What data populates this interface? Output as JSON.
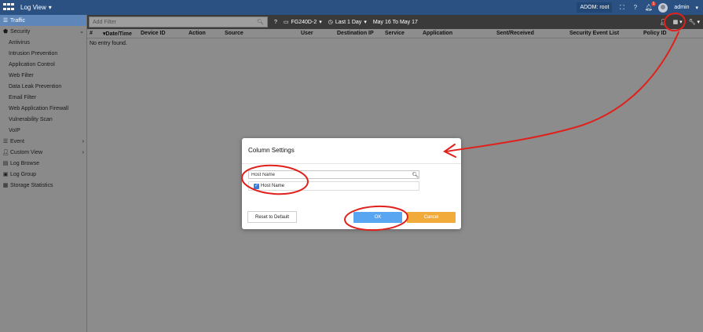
{
  "topbar": {
    "title": "Log View",
    "adom": "ADOM: root",
    "notification_count": "1",
    "user": "admin"
  },
  "sidebar": {
    "items": [
      {
        "label": "Traffic",
        "icon": "list-icon",
        "active": true,
        "sub": false
      },
      {
        "label": "Security",
        "icon": "shield-icon",
        "sub": false,
        "expandable": true
      },
      {
        "label": "Antivirus",
        "sub": true
      },
      {
        "label": "Intrusion Prevention",
        "sub": true
      },
      {
        "label": "Application Control",
        "sub": true
      },
      {
        "label": "Web Filter",
        "sub": true
      },
      {
        "label": "Data Leak Prevention",
        "sub": true
      },
      {
        "label": "Email Filter",
        "sub": true
      },
      {
        "label": "Web Application Firewall",
        "sub": true
      },
      {
        "label": "Vulnerability Scan",
        "sub": true
      },
      {
        "label": "VoIP",
        "sub": true
      },
      {
        "label": "Event",
        "icon": "list-icon",
        "sub": false,
        "expandable": true
      },
      {
        "label": "Custom View",
        "icon": "user-icon",
        "sub": false,
        "expandable": true
      },
      {
        "label": "Log Browse",
        "icon": "file-icon",
        "sub": false
      },
      {
        "label": "Log Group",
        "icon": "folder-icon",
        "sub": false
      },
      {
        "label": "Storage Statistics",
        "icon": "storage-icon",
        "sub": false
      }
    ]
  },
  "toolbar": {
    "filter_placeholder": "Add Filter",
    "device": "FG240D-2",
    "time_range": "Last 1 Day",
    "date_range": "May 16 To May 17"
  },
  "table": {
    "columns": [
      "#",
      "Date/Time",
      "Device ID",
      "Action",
      "Source",
      "User",
      "Destination IP",
      "Service",
      "Application",
      "Sent/Received",
      "Security Event List",
      "Policy ID"
    ],
    "empty_message": "No entry found."
  },
  "modal": {
    "title": "Column Settings",
    "search_value": "Host Name",
    "result_label": "Host Name",
    "result_checked": true,
    "reset_label": "Reset to Default",
    "ok_label": "OK",
    "cancel_label": "Cancel"
  },
  "colors": {
    "topbar": "#2a5182",
    "ok": "#58a6f2",
    "cancel": "#f2ab3a",
    "annotation": "#e0201b"
  }
}
